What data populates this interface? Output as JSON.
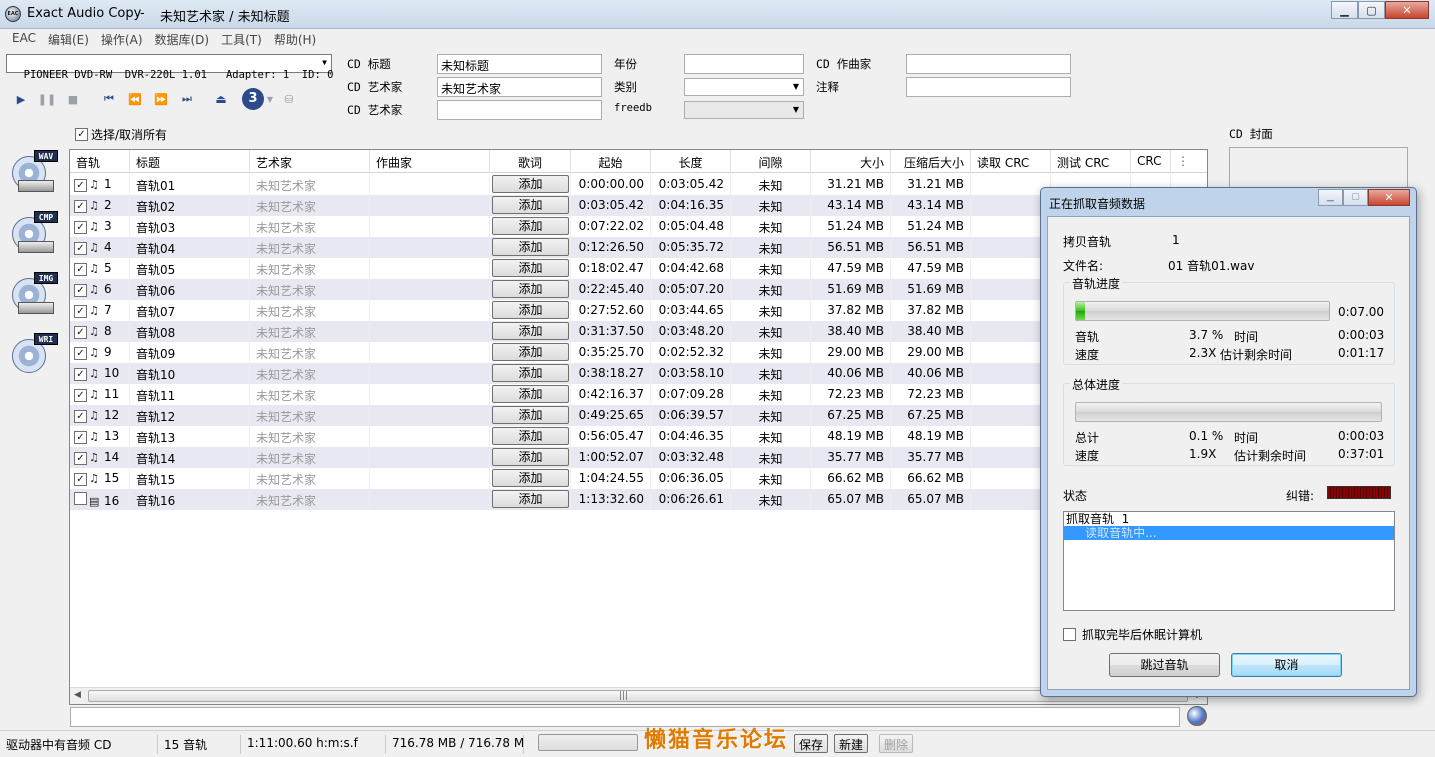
{
  "window": {
    "icon": "EAC",
    "app_title": "Exact Audio Copy",
    "separator": "-",
    "document_title": "未知艺术家 / 未知标题"
  },
  "menu": [
    "EAC",
    "编辑(E)",
    "操作(A)",
    "数据库(D)",
    "工具(T)",
    "帮助(H)"
  ],
  "drive": {
    "selected": "PIONEER DVD-RW  DVR-220L 1.01   Adapter: 1  ID: 0"
  },
  "cd_info": {
    "title_label": "CD 标题",
    "title_value": "未知标题",
    "artist_label": "CD 艺术家",
    "artist_value": "未知艺术家",
    "artist2_label": "CD 艺术家",
    "artist2_value": "",
    "year_label": "年份",
    "year_value": "",
    "genre_label": "类别",
    "genre_value": "",
    "freedb_label": "freedb",
    "freedb_value": "",
    "composer_label": "CD 作曲家",
    "composer_value": "",
    "comment_label": "注释",
    "comment_value": ""
  },
  "toolbar": {
    "disc_number": "3"
  },
  "select_all_label": "选择/取消所有",
  "cover_label": "CD 封面",
  "side_tools": [
    "WAV",
    "CMP",
    "IMG",
    "WRI"
  ],
  "table": {
    "columns": [
      "音轨",
      "标题",
      "艺术家",
      "作曲家",
      "歌词",
      "起始",
      "长度",
      "间隙",
      "大小",
      "压缩后大小",
      "读取 CRC",
      "测试 CRC",
      "CRC"
    ],
    "add_label": "添加",
    "rows": [
      {
        "checked": true,
        "num": "1",
        "title": "音轨01",
        "artist": "未知艺术家",
        "start": "0:00:00.00",
        "length": "0:03:05.42",
        "gap": "未知",
        "size": "31.21 MB",
        "csize": "31.21 MB"
      },
      {
        "checked": true,
        "num": "2",
        "title": "音轨02",
        "artist": "未知艺术家",
        "start": "0:03:05.42",
        "length": "0:04:16.35",
        "gap": "未知",
        "size": "43.14 MB",
        "csize": "43.14 MB"
      },
      {
        "checked": true,
        "num": "3",
        "title": "音轨03",
        "artist": "未知艺术家",
        "start": "0:07:22.02",
        "length": "0:05:04.48",
        "gap": "未知",
        "size": "51.24 MB",
        "csize": "51.24 MB"
      },
      {
        "checked": true,
        "num": "4",
        "title": "音轨04",
        "artist": "未知艺术家",
        "start": "0:12:26.50",
        "length": "0:05:35.72",
        "gap": "未知",
        "size": "56.51 MB",
        "csize": "56.51 MB"
      },
      {
        "checked": true,
        "num": "5",
        "title": "音轨05",
        "artist": "未知艺术家",
        "start": "0:18:02.47",
        "length": "0:04:42.68",
        "gap": "未知",
        "size": "47.59 MB",
        "csize": "47.59 MB"
      },
      {
        "checked": true,
        "num": "6",
        "title": "音轨06",
        "artist": "未知艺术家",
        "start": "0:22:45.40",
        "length": "0:05:07.20",
        "gap": "未知",
        "size": "51.69 MB",
        "csize": "51.69 MB"
      },
      {
        "checked": true,
        "num": "7",
        "title": "音轨07",
        "artist": "未知艺术家",
        "start": "0:27:52.60",
        "length": "0:03:44.65",
        "gap": "未知",
        "size": "37.82 MB",
        "csize": "37.82 MB"
      },
      {
        "checked": true,
        "num": "8",
        "title": "音轨08",
        "artist": "未知艺术家",
        "start": "0:31:37.50",
        "length": "0:03:48.20",
        "gap": "未知",
        "size": "38.40 MB",
        "csize": "38.40 MB"
      },
      {
        "checked": true,
        "num": "9",
        "title": "音轨09",
        "artist": "未知艺术家",
        "start": "0:35:25.70",
        "length": "0:02:52.32",
        "gap": "未知",
        "size": "29.00 MB",
        "csize": "29.00 MB"
      },
      {
        "checked": true,
        "num": "10",
        "title": "音轨10",
        "artist": "未知艺术家",
        "start": "0:38:18.27",
        "length": "0:03:58.10",
        "gap": "未知",
        "size": "40.06 MB",
        "csize": "40.06 MB"
      },
      {
        "checked": true,
        "num": "11",
        "title": "音轨11",
        "artist": "未知艺术家",
        "start": "0:42:16.37",
        "length": "0:07:09.28",
        "gap": "未知",
        "size": "72.23 MB",
        "csize": "72.23 MB"
      },
      {
        "checked": true,
        "num": "12",
        "title": "音轨12",
        "artist": "未知艺术家",
        "start": "0:49:25.65",
        "length": "0:06:39.57",
        "gap": "未知",
        "size": "67.25 MB",
        "csize": "67.25 MB"
      },
      {
        "checked": true,
        "num": "13",
        "title": "音轨13",
        "artist": "未知艺术家",
        "start": "0:56:05.47",
        "length": "0:04:46.35",
        "gap": "未知",
        "size": "48.19 MB",
        "csize": "48.19 MB"
      },
      {
        "checked": true,
        "num": "14",
        "title": "音轨14",
        "artist": "未知艺术家",
        "start": "1:00:52.07",
        "length": "0:03:32.48",
        "gap": "未知",
        "size": "35.77 MB",
        "csize": "35.77 MB"
      },
      {
        "checked": true,
        "num": "15",
        "title": "音轨15",
        "artist": "未知艺术家",
        "start": "1:04:24.55",
        "length": "0:06:36.05",
        "gap": "未知",
        "size": "66.62 MB",
        "csize": "66.62 MB"
      },
      {
        "checked": false,
        "num": "16",
        "title": "音轨16",
        "artist": "未知艺术家",
        "start": "1:13:32.60",
        "length": "0:06:26.61",
        "gap": "未知",
        "size": "65.07 MB",
        "csize": "65.07 MB"
      }
    ]
  },
  "statusbar": {
    "drive_status": "驱动器中有音频 CD",
    "track_count": "15 音轨",
    "total_time": "1:11:00.60 h:m:s.f",
    "total_size": "716.78 MB / 716.78 M",
    "save_label": "保存",
    "new_label": "新建",
    "delete_label": "删除",
    "watermark": "懒猫音乐论坛"
  },
  "dialog": {
    "title": "正在抓取音频数据",
    "copy_track_label": "拷贝音轨",
    "copy_track_value": "1",
    "filename_label": "文件名:",
    "filename_value": "01 音轨01.wav",
    "track_progress": {
      "group_label": "音轨进度",
      "total_time": "0:07.00",
      "track_label": "音轨",
      "track_percent": "3.7 %",
      "time_label": "时间",
      "time_value": "0:00:03",
      "speed_label": "速度",
      "speed_value": "2.3X",
      "remain_label": "估计剩余时间",
      "remain_value": "0:01:17",
      "fill": 0.037
    },
    "overall_progress": {
      "group_label": "总体进度",
      "total_label": "总计",
      "total_percent": "0.1 %",
      "time_label": "时间",
      "time_value": "0:00:03",
      "speed_label": "速度",
      "speed_value": "1.9X",
      "remain_label": "估计剩余时间",
      "remain_value": "0:37:01",
      "fill": 0.001
    },
    "status_label": "状态",
    "error_label": "纠错:",
    "status_lines": [
      "抓取音轨  1",
      "     读取音轨中..."
    ],
    "sleep_label": "抓取完毕后休眠计算机",
    "skip_label": "跳过音轨",
    "cancel_label": "取消"
  }
}
